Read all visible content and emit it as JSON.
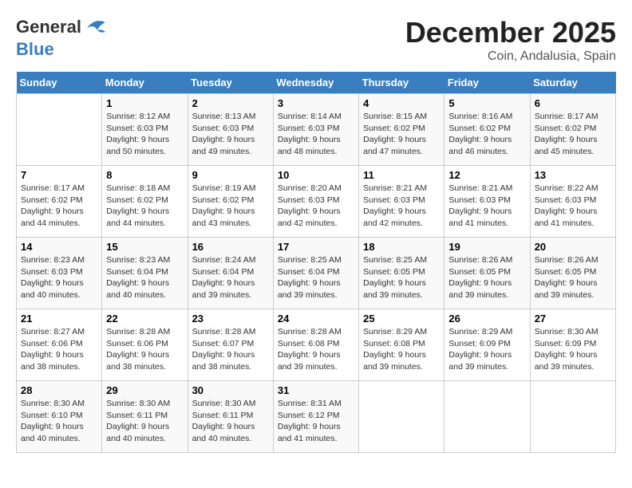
{
  "header": {
    "logo_line1": "General",
    "logo_line2": "Blue",
    "month_year": "December 2025",
    "location": "Coin, Andalusia, Spain"
  },
  "days_of_week": [
    "Sunday",
    "Monday",
    "Tuesday",
    "Wednesday",
    "Thursday",
    "Friday",
    "Saturday"
  ],
  "weeks": [
    [
      {
        "day": "",
        "info": ""
      },
      {
        "day": "1",
        "info": "Sunrise: 8:12 AM\nSunset: 6:03 PM\nDaylight: 9 hours\nand 50 minutes."
      },
      {
        "day": "2",
        "info": "Sunrise: 8:13 AM\nSunset: 6:03 PM\nDaylight: 9 hours\nand 49 minutes."
      },
      {
        "day": "3",
        "info": "Sunrise: 8:14 AM\nSunset: 6:03 PM\nDaylight: 9 hours\nand 48 minutes."
      },
      {
        "day": "4",
        "info": "Sunrise: 8:15 AM\nSunset: 6:02 PM\nDaylight: 9 hours\nand 47 minutes."
      },
      {
        "day": "5",
        "info": "Sunrise: 8:16 AM\nSunset: 6:02 PM\nDaylight: 9 hours\nand 46 minutes."
      },
      {
        "day": "6",
        "info": "Sunrise: 8:17 AM\nSunset: 6:02 PM\nDaylight: 9 hours\nand 45 minutes."
      }
    ],
    [
      {
        "day": "7",
        "info": "Sunrise: 8:17 AM\nSunset: 6:02 PM\nDaylight: 9 hours\nand 44 minutes."
      },
      {
        "day": "8",
        "info": "Sunrise: 8:18 AM\nSunset: 6:02 PM\nDaylight: 9 hours\nand 44 minutes."
      },
      {
        "day": "9",
        "info": "Sunrise: 8:19 AM\nSunset: 6:02 PM\nDaylight: 9 hours\nand 43 minutes."
      },
      {
        "day": "10",
        "info": "Sunrise: 8:20 AM\nSunset: 6:03 PM\nDaylight: 9 hours\nand 42 minutes."
      },
      {
        "day": "11",
        "info": "Sunrise: 8:21 AM\nSunset: 6:03 PM\nDaylight: 9 hours\nand 42 minutes."
      },
      {
        "day": "12",
        "info": "Sunrise: 8:21 AM\nSunset: 6:03 PM\nDaylight: 9 hours\nand 41 minutes."
      },
      {
        "day": "13",
        "info": "Sunrise: 8:22 AM\nSunset: 6:03 PM\nDaylight: 9 hours\nand 41 minutes."
      }
    ],
    [
      {
        "day": "14",
        "info": "Sunrise: 8:23 AM\nSunset: 6:03 PM\nDaylight: 9 hours\nand 40 minutes."
      },
      {
        "day": "15",
        "info": "Sunrise: 8:23 AM\nSunset: 6:04 PM\nDaylight: 9 hours\nand 40 minutes."
      },
      {
        "day": "16",
        "info": "Sunrise: 8:24 AM\nSunset: 6:04 PM\nDaylight: 9 hours\nand 39 minutes."
      },
      {
        "day": "17",
        "info": "Sunrise: 8:25 AM\nSunset: 6:04 PM\nDaylight: 9 hours\nand 39 minutes."
      },
      {
        "day": "18",
        "info": "Sunrise: 8:25 AM\nSunset: 6:05 PM\nDaylight: 9 hours\nand 39 minutes."
      },
      {
        "day": "19",
        "info": "Sunrise: 8:26 AM\nSunset: 6:05 PM\nDaylight: 9 hours\nand 39 minutes."
      },
      {
        "day": "20",
        "info": "Sunrise: 8:26 AM\nSunset: 6:05 PM\nDaylight: 9 hours\nand 39 minutes."
      }
    ],
    [
      {
        "day": "21",
        "info": "Sunrise: 8:27 AM\nSunset: 6:06 PM\nDaylight: 9 hours\nand 38 minutes."
      },
      {
        "day": "22",
        "info": "Sunrise: 8:28 AM\nSunset: 6:06 PM\nDaylight: 9 hours\nand 38 minutes."
      },
      {
        "day": "23",
        "info": "Sunrise: 8:28 AM\nSunset: 6:07 PM\nDaylight: 9 hours\nand 38 minutes."
      },
      {
        "day": "24",
        "info": "Sunrise: 8:28 AM\nSunset: 6:08 PM\nDaylight: 9 hours\nand 39 minutes."
      },
      {
        "day": "25",
        "info": "Sunrise: 8:29 AM\nSunset: 6:08 PM\nDaylight: 9 hours\nand 39 minutes."
      },
      {
        "day": "26",
        "info": "Sunrise: 8:29 AM\nSunset: 6:09 PM\nDaylight: 9 hours\nand 39 minutes."
      },
      {
        "day": "27",
        "info": "Sunrise: 8:30 AM\nSunset: 6:09 PM\nDaylight: 9 hours\nand 39 minutes."
      }
    ],
    [
      {
        "day": "28",
        "info": "Sunrise: 8:30 AM\nSunset: 6:10 PM\nDaylight: 9 hours\nand 40 minutes."
      },
      {
        "day": "29",
        "info": "Sunrise: 8:30 AM\nSunset: 6:11 PM\nDaylight: 9 hours\nand 40 minutes."
      },
      {
        "day": "30",
        "info": "Sunrise: 8:30 AM\nSunset: 6:11 PM\nDaylight: 9 hours\nand 40 minutes."
      },
      {
        "day": "31",
        "info": "Sunrise: 8:31 AM\nSunset: 6:12 PM\nDaylight: 9 hours\nand 41 minutes."
      },
      {
        "day": "",
        "info": ""
      },
      {
        "day": "",
        "info": ""
      },
      {
        "day": "",
        "info": ""
      }
    ]
  ]
}
